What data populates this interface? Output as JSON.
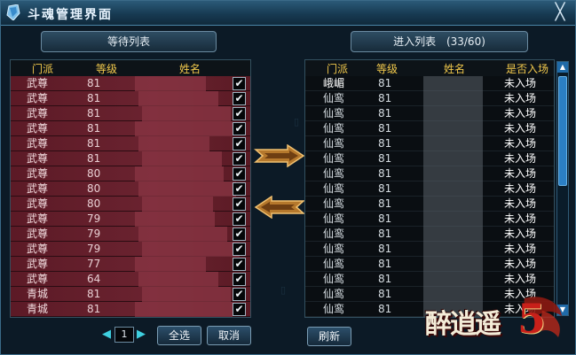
{
  "title": "斗魂管理界面",
  "close_glyph": "╳",
  "waiting_list": {
    "header_label": "等待列表",
    "columns": {
      "sect": "门派",
      "level": "等级",
      "name": "姓名"
    },
    "rows": [
      {
        "sect": "武尊",
        "level": "81"
      },
      {
        "sect": "武尊",
        "level": "81"
      },
      {
        "sect": "武尊",
        "level": "81"
      },
      {
        "sect": "武尊",
        "level": "81"
      },
      {
        "sect": "武尊",
        "level": "81"
      },
      {
        "sect": "武尊",
        "level": "81"
      },
      {
        "sect": "武尊",
        "level": "80"
      },
      {
        "sect": "武尊",
        "level": "80"
      },
      {
        "sect": "武尊",
        "level": "80"
      },
      {
        "sect": "武尊",
        "level": "79"
      },
      {
        "sect": "武尊",
        "level": "79"
      },
      {
        "sect": "武尊",
        "level": "79"
      },
      {
        "sect": "武尊",
        "level": "77"
      },
      {
        "sect": "武尊",
        "level": "64"
      },
      {
        "sect": "青城",
        "level": "81"
      },
      {
        "sect": "青城",
        "level": "81"
      }
    ],
    "check_glyph": "✔"
  },
  "entered_list": {
    "header_label": "进入列表",
    "header_count": "(33/60)",
    "columns": {
      "sect": "门派",
      "level": "等级",
      "name": "姓名",
      "status": "是否入场"
    },
    "rows": [
      {
        "sect": "峨嵋",
        "level": "81",
        "status": "未入场"
      },
      {
        "sect": "仙鸾",
        "level": "81",
        "status": "未入场"
      },
      {
        "sect": "仙鸾",
        "level": "81",
        "status": "未入场"
      },
      {
        "sect": "仙鸾",
        "level": "81",
        "status": "未入场"
      },
      {
        "sect": "仙鸾",
        "level": "81",
        "status": "未入场"
      },
      {
        "sect": "仙鸾",
        "level": "81",
        "status": "未入场"
      },
      {
        "sect": "仙鸾",
        "level": "81",
        "status": "未入场"
      },
      {
        "sect": "仙鸾",
        "level": "81",
        "status": "未入场"
      },
      {
        "sect": "仙鸾",
        "level": "81",
        "status": "未入场"
      },
      {
        "sect": "仙鸾",
        "level": "81",
        "status": "未入场"
      },
      {
        "sect": "仙鸾",
        "level": "81",
        "status": "未入场"
      },
      {
        "sect": "仙鸾",
        "level": "81",
        "status": "未入场"
      },
      {
        "sect": "仙鸾",
        "level": "81",
        "status": "未入场"
      },
      {
        "sect": "仙鸾",
        "level": "81",
        "status": "未入场"
      },
      {
        "sect": "仙鸾",
        "level": "81",
        "status": "未入场"
      },
      {
        "sect": "仙鸾",
        "level": "81",
        "status": "未入场"
      }
    ]
  },
  "pager": {
    "prev_glyph": "◀",
    "next_glyph": "▶",
    "page": "1"
  },
  "buttons": {
    "select_all": "全选",
    "cancel": "取消",
    "refresh": "刷新"
  },
  "logo_text": "醉逍遥",
  "logo_number": "5",
  "colors": {
    "column_header": "#f2c94c",
    "wait_row": "#6b2330",
    "accent_blue": "#2b7fc4"
  }
}
